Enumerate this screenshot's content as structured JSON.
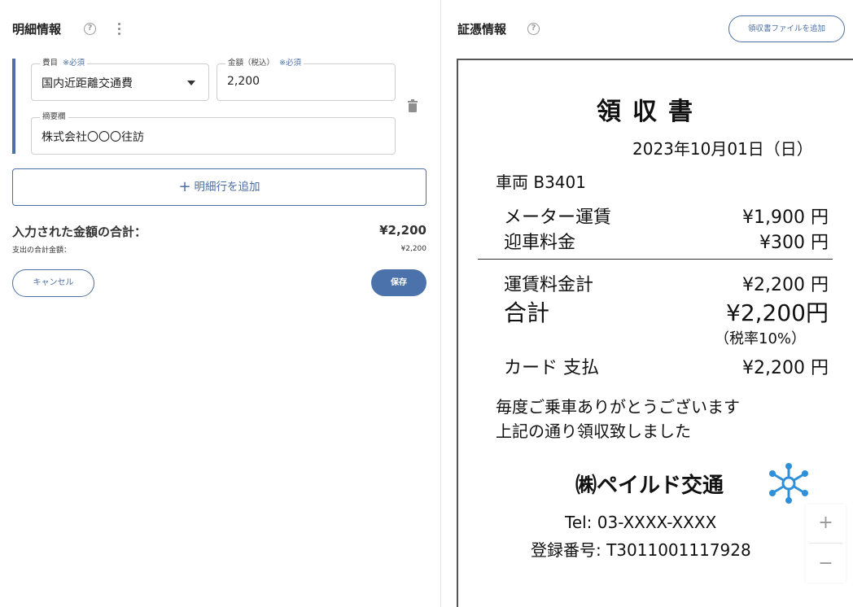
{
  "left": {
    "title": "明細情報",
    "help_icon": "?",
    "row": {
      "category_label": "費目",
      "category_required": "※必須",
      "category_value": "国内近距離交通費",
      "amount_label": "金額（税込）",
      "amount_required": "※必須",
      "amount_value": "2,200",
      "memo_label": "摘要欄",
      "memo_value": "株式会社〇〇〇往訪"
    },
    "add_row_plus": "+",
    "add_row_label": "明細行を追加",
    "total_label": "入力された金額の合計：",
    "total_value": "¥2,200",
    "expense_total_label": "支出の合計金額：",
    "expense_total_value": "¥2,200",
    "cancel_label": "キャンセル",
    "save_label": "保存"
  },
  "right": {
    "title": "証憑情報",
    "help_icon": "?",
    "add_file_label": "領収書ファイルを追加",
    "zoom_in": "+",
    "zoom_out": "−"
  },
  "receipt": {
    "title": "領収書",
    "date": "2023年10月01日（日）",
    "vehicle": "車両 B3401",
    "meter_label": "メーター運賃",
    "meter_value": "¥1,900 円",
    "pickup_label": "迎車料金",
    "pickup_value": "¥300 円",
    "fare_total_label": "運賃料金計",
    "fare_total_value": "¥2,200 円",
    "total_label": "合計",
    "total_value": "¥2,200円",
    "tax_note": "（税率10%）",
    "card_label": "カード 支払",
    "card_value": "¥2,200 円",
    "thanks_1": "毎度ご乗車ありがとうございます",
    "thanks_2": "上記の通り領収致しました",
    "company": "㈱ペイルド交通",
    "tel": "Tel: 03-XXXX-XXXX",
    "registration": "登録番号: T3011001117928"
  },
  "colors": {
    "accent": "#4c6fa5",
    "save_button": "#4c72ab",
    "logo": "#2f8fd8"
  },
  "icons": [
    "help-icon",
    "kebab-menu-icon",
    "dropdown-caret-icon",
    "trash-icon",
    "plus-icon",
    "hub-logo-icon",
    "zoom-in-icon",
    "zoom-out-icon"
  ]
}
